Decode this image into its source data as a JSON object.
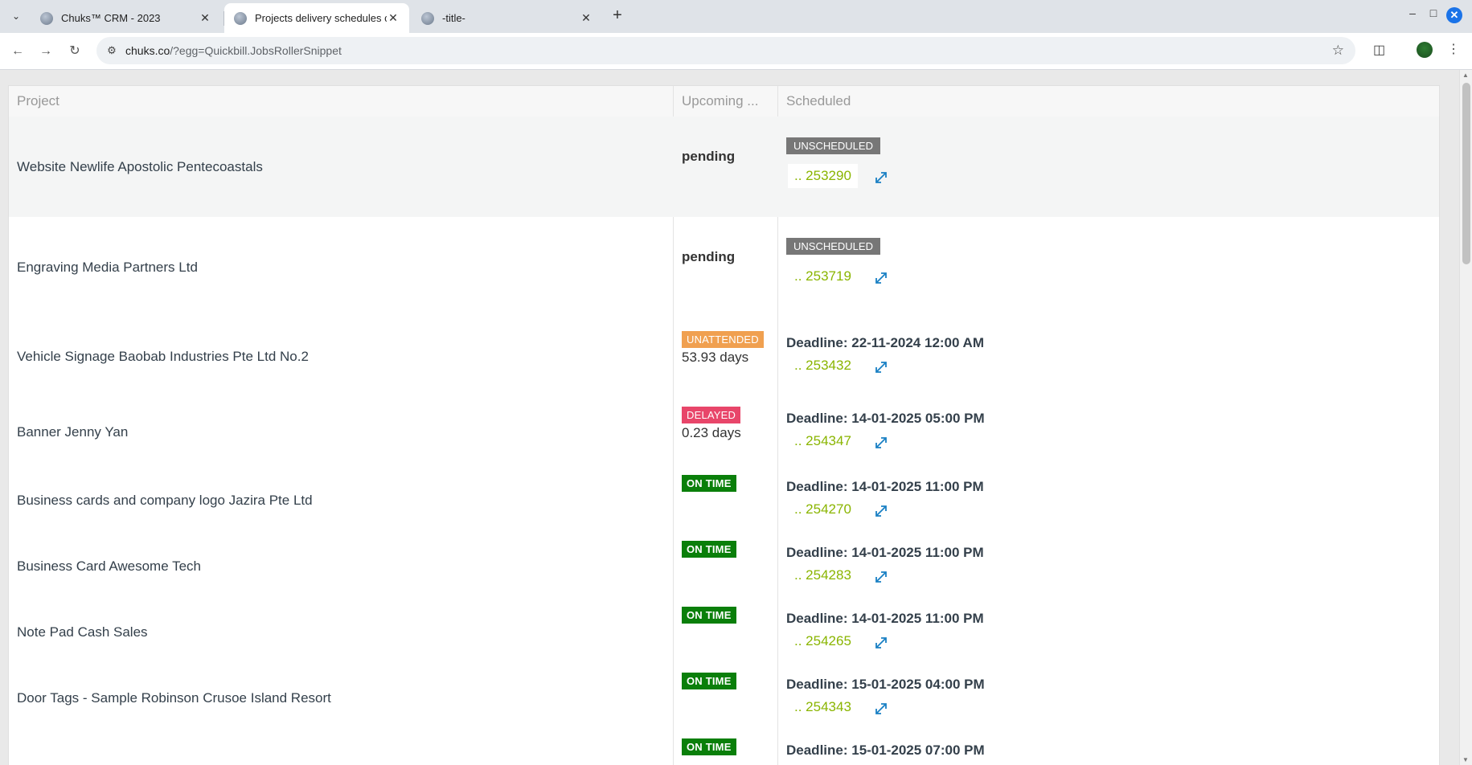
{
  "browser": {
    "tabs": [
      {
        "title": "Chuks™ CRM - 2023",
        "active": false
      },
      {
        "title": "Projects delivery schedules c",
        "active": true
      },
      {
        "title": "-title-",
        "active": false
      }
    ],
    "url_host": "chuks.co",
    "url_path": "/?egg=Quickbill.JobsRollerSnippet"
  },
  "grid": {
    "columns": [
      "Project",
      "Upcoming ...",
      "Scheduled"
    ],
    "rows": [
      {
        "project": "Website Newlife Apostolic Pentecoastals",
        "status": "pending",
        "status_type": "pending",
        "days": "",
        "scheduled": "UNSCHEDULED",
        "sched_type": "unscheduled",
        "job": ".. 253290"
      },
      {
        "project": "Engraving Media Partners Ltd",
        "status": "pending",
        "status_type": "pending",
        "days": "",
        "scheduled": "UNSCHEDULED",
        "sched_type": "unscheduled",
        "job": ".. 253719"
      },
      {
        "project": "Vehicle Signage Baobab Industries Pte Ltd No.2",
        "status": "UNATTENDED",
        "status_type": "unattended",
        "days": "53.93 days",
        "scheduled": "Deadline: 22-11-2024 12:00 AM",
        "sched_type": "deadline",
        "job": ".. 253432"
      },
      {
        "project": "Banner Jenny Yan",
        "status": "DELAYED",
        "status_type": "delayed",
        "days": "0.23 days",
        "scheduled": "Deadline: 14-01-2025 05:00 PM",
        "sched_type": "deadline",
        "job": ".. 254347"
      },
      {
        "project": "Business cards and company logo Jazira Pte Ltd",
        "status": "ON TIME",
        "status_type": "ontime",
        "days": "",
        "scheduled": "Deadline: 14-01-2025 11:00 PM",
        "sched_type": "deadline",
        "job": ".. 254270"
      },
      {
        "project": "Business Card Awesome Tech",
        "status": "ON TIME",
        "status_type": "ontime",
        "days": "",
        "scheduled": "Deadline: 14-01-2025 11:00 PM",
        "sched_type": "deadline",
        "job": ".. 254283"
      },
      {
        "project": "Note Pad Cash Sales",
        "status": "ON TIME",
        "status_type": "ontime",
        "days": "",
        "scheduled": "Deadline: 14-01-2025 11:00 PM",
        "sched_type": "deadline",
        "job": ".. 254265"
      },
      {
        "project": "Door Tags - Sample Robinson Crusoe Island Resort",
        "status": "ON TIME",
        "status_type": "ontime",
        "days": "",
        "scheduled": "Deadline: 15-01-2025 04:00 PM",
        "sched_type": "deadline",
        "job": ".. 254343"
      },
      {
        "project": "",
        "status": "ON TIME",
        "status_type": "ontime",
        "days": "",
        "scheduled": "Deadline: 15-01-2025 07:00 PM",
        "sched_type": "deadline",
        "job": ""
      }
    ]
  },
  "colors": {
    "unattended": "#f0a050",
    "delayed": "#e8466a",
    "ontime": "#0a7f0a",
    "unscheduled": "#777777",
    "job_link": "#8ab500",
    "expand_icon": "#1a80c4"
  }
}
